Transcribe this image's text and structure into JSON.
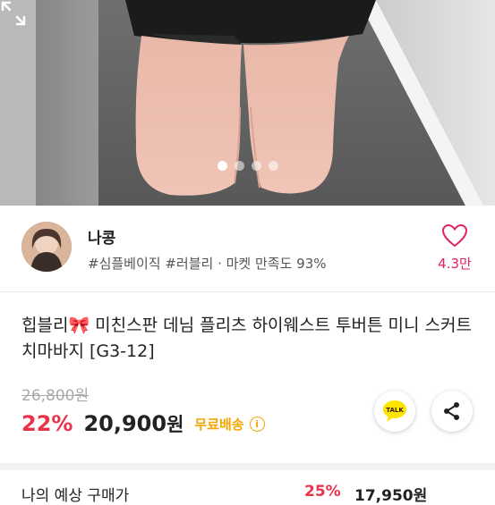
{
  "product_image": {
    "alt": "",
    "pager_count": 4,
    "pager_active": 0
  },
  "seller": {
    "name": "나콩",
    "tags": "#심플베이직 #러블리 · 마켓 만족도 93%",
    "like_count": "4.3만"
  },
  "product": {
    "title": "힙블리🎀 미친스판 데님 플리츠 하이웨스트 투버튼 미니 스커트 치마바지 [G3-12]",
    "original_price": "26,800원",
    "discount": "22%",
    "price": "20,900",
    "currency": "원",
    "shipping": "무료배송",
    "info": "i"
  },
  "actions": {
    "kakao_label": "TALK"
  },
  "bottom": {
    "label": "나의 예상 구매가",
    "discount": "25%",
    "price": "17,950원"
  },
  "colors": {
    "accent_red": "#e8334a",
    "like_pink": "#e0245e",
    "shipping_yellow": "#f2a600",
    "kakao_yellow": "#fee500"
  }
}
